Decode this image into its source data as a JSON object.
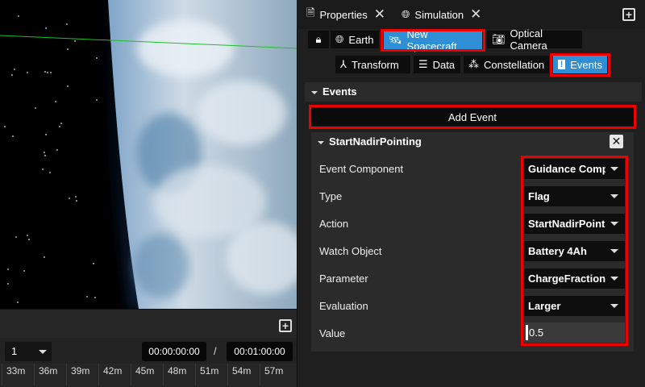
{
  "viewport": {},
  "timeline": {
    "speed": "1",
    "current_time": "00:00:00:00",
    "separator": "/",
    "end_time": "00:01:00:00",
    "ticks": [
      "33m",
      "36m",
      "39m",
      "42m",
      "45m",
      "48m",
      "51m",
      "54m",
      "57m"
    ]
  },
  "tabs": [
    {
      "label": "Properties",
      "icon": "document-icon"
    },
    {
      "label": "Simulation",
      "icon": "globe-icon"
    }
  ],
  "objects": [
    {
      "label": "",
      "icon": "lock-icon"
    },
    {
      "label": "Earth",
      "icon": "globe-icon"
    },
    {
      "label": "New Spacecraft",
      "icon": "satellite-icon",
      "active": true
    },
    {
      "label": "Optical Camera",
      "icon": "camera-icon"
    }
  ],
  "subtabs": [
    {
      "label": "Transform",
      "icon": "axes-icon"
    },
    {
      "label": "Data",
      "icon": "list-icon"
    },
    {
      "label": "Constellation",
      "icon": "constellation-icon"
    },
    {
      "label": "Events",
      "icon": "alert-icon",
      "active": true
    }
  ],
  "events": {
    "section_title": "Events",
    "add_button": "Add Event",
    "event_name": "StartNadirPointing",
    "fields": [
      {
        "label": "Event Component",
        "value": "Guidance Computer"
      },
      {
        "label": "Type",
        "value": "Flag"
      },
      {
        "label": "Action",
        "value": "StartNadirPointing"
      },
      {
        "label": "Watch Object",
        "value": "Battery 4Ah"
      },
      {
        "label": "Parameter",
        "value": "ChargeFraction"
      },
      {
        "label": "Evaluation",
        "value": "Larger"
      }
    ],
    "value_label": "Value",
    "value": "0.5"
  },
  "colors": {
    "accent": "#2e8fd6",
    "highlight": "#e00000",
    "panel_bg": "#1f1f1f"
  }
}
